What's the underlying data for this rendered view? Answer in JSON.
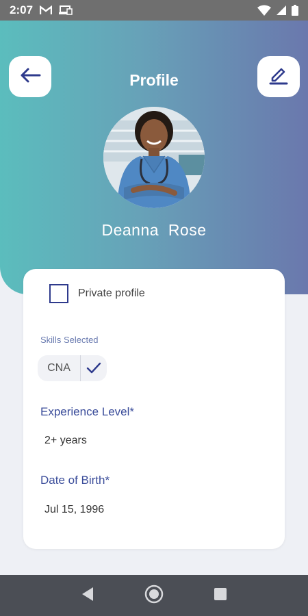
{
  "status_bar": {
    "time": "2:07",
    "icons": [
      "gmail-icon",
      "cast-icon",
      "wifi-icon",
      "signal-icon",
      "battery-icon"
    ]
  },
  "header": {
    "title": "Profile",
    "back_icon": "arrow-left-icon",
    "edit_icon": "pencil-icon",
    "gradient": [
      "#5bbdbd",
      "#6a78ad"
    ]
  },
  "profile": {
    "name": "Deanna  Rose"
  },
  "card": {
    "private_profile": {
      "label": "Private profile",
      "checked": false
    },
    "skills_label": "Skills Selected",
    "skills": [
      {
        "name": "CNA",
        "selected": true
      }
    ],
    "experience": {
      "label": "Experience Level*",
      "value": "2+ years"
    },
    "dob": {
      "label": "Date of Birth*",
      "value": "Jul 15, 1996"
    }
  },
  "nav": {
    "icons": [
      "nav-back-icon",
      "nav-home-icon",
      "nav-recents-icon"
    ]
  },
  "colors": {
    "accent": "#2e3a8c",
    "label_blue": "#3a4c9a",
    "status_bar": "#6f6f6f",
    "nav_bar": "#4b4e55"
  }
}
